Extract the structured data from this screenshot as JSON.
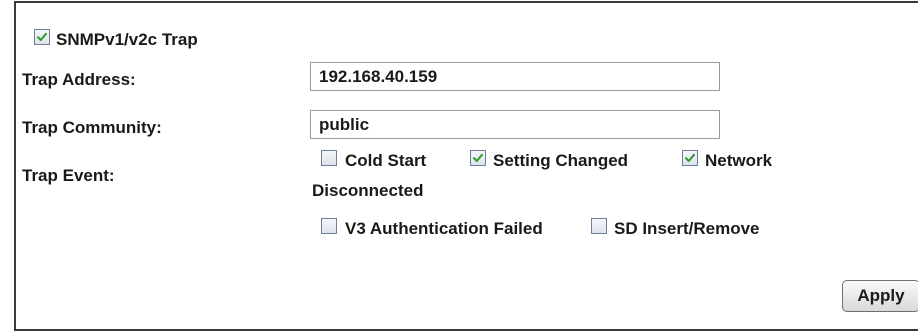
{
  "snmp": {
    "trap_enable": {
      "label": "SNMPv1/v2c Trap",
      "checked": true
    },
    "trap_address": {
      "label": "Trap Address:",
      "value": "192.168.40.159"
    },
    "trap_community": {
      "label": "Trap Community:",
      "value": "public"
    },
    "trap_event": {
      "label": "Trap Event:",
      "options": [
        {
          "label": "Cold Start",
          "checked": false
        },
        {
          "label": "Setting Changed",
          "checked": true
        },
        {
          "label": "Network",
          "checked": true
        },
        {
          "label": "V3 Authentication Failed",
          "checked": false
        },
        {
          "label": "SD Insert/Remove",
          "checked": false
        }
      ],
      "wrap_text": "Disconnected"
    },
    "apply_label": "Apply"
  },
  "colors": {
    "check_mark": "#2e9b2e",
    "checkbox_border": "#6d7f9c",
    "panel_border": "#3a3a3a"
  }
}
